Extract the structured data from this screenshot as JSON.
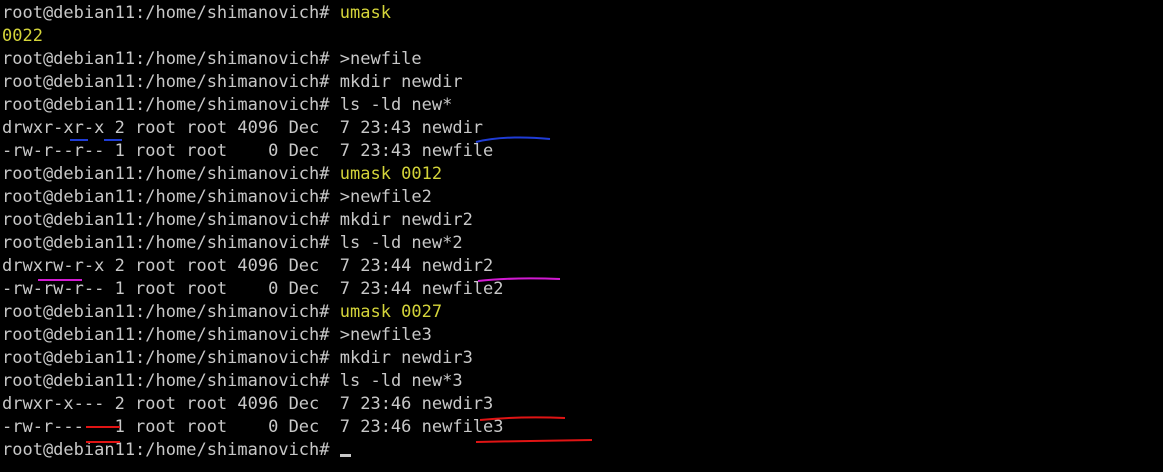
{
  "terminal": {
    "lines": [
      {
        "type": "cmd",
        "prompt": "root@debian11:/home/shimanovich# ",
        "text": "umask",
        "hl": true
      },
      {
        "type": "out",
        "text": "0022",
        "hl": true
      },
      {
        "type": "cmd",
        "prompt": "root@debian11:/home/shimanovich# ",
        "text": ">newfile",
        "hl": false
      },
      {
        "type": "cmd",
        "prompt": "root@debian11:/home/shimanovich# ",
        "text": "mkdir newdir",
        "hl": false
      },
      {
        "type": "cmd",
        "prompt": "root@debian11:/home/shimanovich# ",
        "text": "ls -ld new*",
        "hl": false
      },
      {
        "type": "out",
        "text": "drwxr-xr-x 2 root root 4096 Dec  7 23:43 newdir",
        "hl": false
      },
      {
        "type": "out",
        "text": "-rw-r--r-- 1 root root    0 Dec  7 23:43 newfile",
        "hl": false
      },
      {
        "type": "cmd",
        "prompt": "root@debian11:/home/shimanovich# ",
        "text": "umask 0012",
        "hl": true
      },
      {
        "type": "cmd",
        "prompt": "root@debian11:/home/shimanovich# ",
        "text": ">newfile2",
        "hl": false
      },
      {
        "type": "cmd",
        "prompt": "root@debian11:/home/shimanovich# ",
        "text": "mkdir newdir2",
        "hl": false
      },
      {
        "type": "cmd",
        "prompt": "root@debian11:/home/shimanovich# ",
        "text": "ls -ld new*2",
        "hl": false
      },
      {
        "type": "out",
        "text": "drwxrw-r-x 2 root root 4096 Dec  7 23:44 newdir2",
        "hl": false
      },
      {
        "type": "out",
        "text": "-rw-rw-r-- 1 root root    0 Dec  7 23:44 newfile2",
        "hl": false
      },
      {
        "type": "cmd",
        "prompt": "root@debian11:/home/shimanovich# ",
        "text": "umask 0027",
        "hl": true
      },
      {
        "type": "cmd",
        "prompt": "root@debian11:/home/shimanovich# ",
        "text": ">newfile3",
        "hl": false
      },
      {
        "type": "cmd",
        "prompt": "root@debian11:/home/shimanovich# ",
        "text": "mkdir newdir3",
        "hl": false
      },
      {
        "type": "cmd",
        "prompt": "root@debian11:/home/shimanovich# ",
        "text": "ls -ld new*3",
        "hl": false
      },
      {
        "type": "out",
        "text": "drwxr-x--- 2 root root 4096 Dec  7 23:46 newdir3",
        "hl": false
      },
      {
        "type": "out",
        "text": "-rw-r----- 1 root root    0 Dec  7 23:46 newfile3",
        "hl": false
      },
      {
        "type": "prompt",
        "prompt": "root@debian11:/home/shimanovich# ",
        "text": "",
        "hl": false
      }
    ]
  },
  "annotations": {
    "colors": {
      "blue": "#1f3cd6",
      "magenta": "#d21ad2",
      "red": "#e01414"
    }
  },
  "colors": {
    "background": "#000000",
    "text": "#c8c8c8",
    "highlight": "#d4d43a"
  }
}
